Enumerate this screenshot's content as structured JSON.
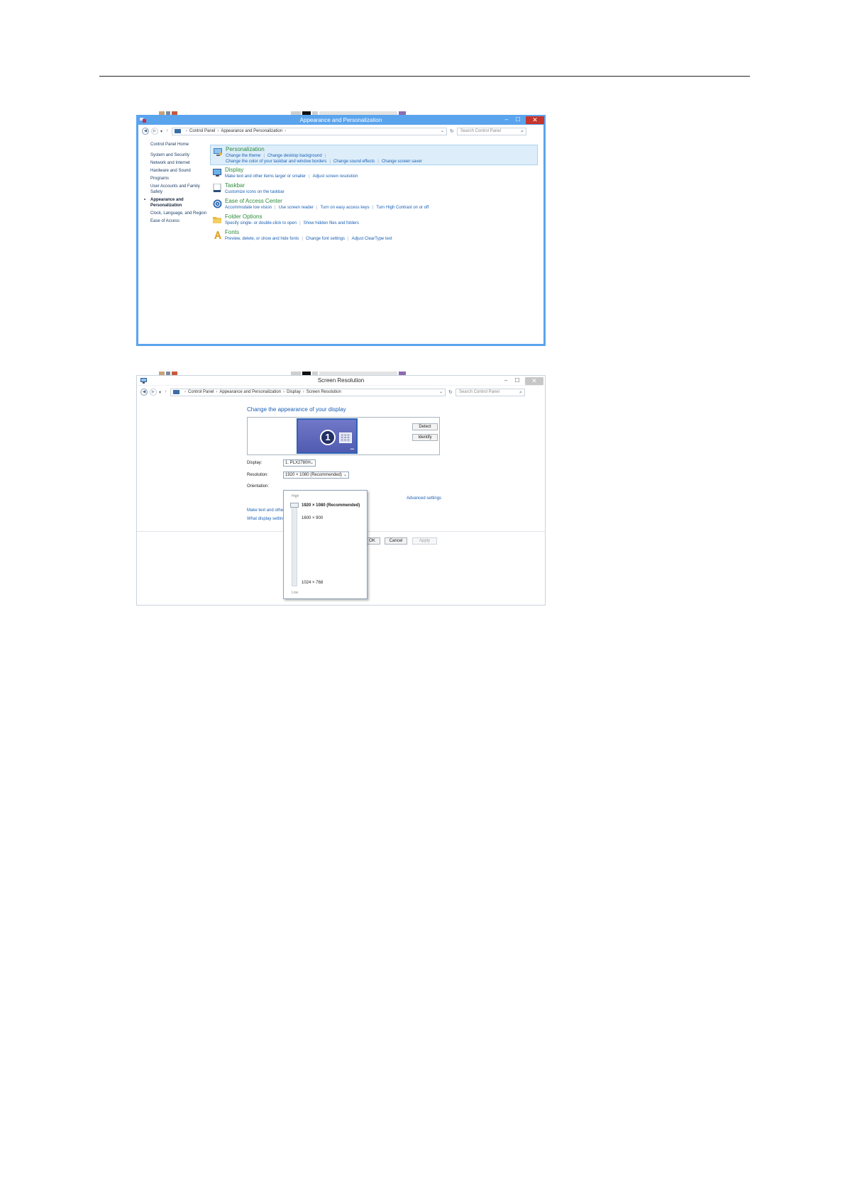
{
  "window1": {
    "title": "Appearance and Personalization",
    "window_controls": {
      "minimize": "–",
      "maximize": "☐",
      "close": "✕"
    },
    "address": {
      "breadcrumbs": [
        "Control Panel",
        "Appearance and Personalization"
      ],
      "search_placeholder": "Search Control Panel"
    },
    "leftnav": {
      "home": "Control Panel Home",
      "items": [
        "System and Security",
        "Network and Internet",
        "Hardware and Sound",
        "Programs",
        "User Accounts and Family Safety",
        "Appearance and Personalization",
        "Clock, Language, and Region",
        "Ease of Access"
      ]
    },
    "categories": [
      {
        "title": "Personalization",
        "icon": "personalization-icon",
        "links": [
          "Change the theme",
          "Change desktop background"
        ],
        "links2": [
          "Change the color of your taskbar and window borders",
          "Change sound effects",
          "Change screen saver"
        ]
      },
      {
        "title": "Display",
        "icon": "display-icon",
        "links": [
          "Make text and other items larger or smaller",
          "Adjust screen resolution"
        ]
      },
      {
        "title": "Taskbar",
        "icon": "taskbar-icon",
        "links": [
          "Customize icons on the taskbar"
        ]
      },
      {
        "title": "Ease of Access Center",
        "icon": "ease-of-access-icon",
        "links": [
          "Accommodate low vision",
          "Use screen reader",
          "Turn on easy access keys",
          "Turn High Contrast on or off"
        ]
      },
      {
        "title": "Folder Options",
        "icon": "folder-icon",
        "links": [
          "Specify single- or double-click to open",
          "Show hidden files and folders"
        ]
      },
      {
        "title": "Fonts",
        "icon": "fonts-icon",
        "links": [
          "Preview, delete, or show and hide fonts",
          "Change font settings",
          "Adjust ClearType text"
        ]
      }
    ]
  },
  "window2": {
    "title": "Screen Resolution",
    "window_controls": {
      "minimize": "–",
      "maximize": "☐",
      "close": "✕"
    },
    "address": {
      "breadcrumbs": [
        "Control Panel",
        "Appearance and Personalization",
        "Display",
        "Screen Resolution"
      ],
      "search_placeholder": "Search Control Panel"
    },
    "heading": "Change the appearance of your display",
    "monitor_number": "1",
    "detect_label": "Detect",
    "identify_label": "Identify",
    "display_label": "Display:",
    "display_value": "1. PLX2780H",
    "resolution_label": "Resolution:",
    "resolution_value": "1920 × 1080 (Recommended)",
    "orientation_label": "Orientation:",
    "advanced_link": "Advanced settings",
    "link_text_size": "Make text and other",
    "link_display_settings": "What display setting",
    "ok_label": "OK",
    "cancel_label": "Cancel",
    "apply_label": "Apply",
    "dropdown": {
      "high_label": "High",
      "low_label": "Low",
      "options": [
        "1920 × 1080 (Recommended)",
        "1600 × 900",
        "1024 × 768"
      ]
    }
  }
}
